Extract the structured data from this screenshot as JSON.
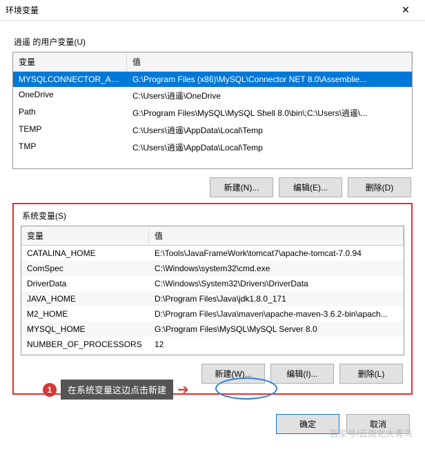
{
  "title": "环境变量",
  "user_section": {
    "label": "逍遥 的用户变量(U)",
    "columns": {
      "name": "变量",
      "value": "值"
    },
    "rows": [
      {
        "name": "MYSQLCONNECTOR_ASS...",
        "value": "G:\\Program Files (x86)\\MySQL\\Connector NET 8.0\\Assemblie...",
        "selected": true
      },
      {
        "name": "OneDrive",
        "value": "C:\\Users\\逍遥\\OneDrive"
      },
      {
        "name": "Path",
        "value": "G:\\Program Files\\MySQL\\MySQL Shell 8.0\\bin\\;C:\\Users\\逍遥\\..."
      },
      {
        "name": "TEMP",
        "value": "C:\\Users\\逍遥\\AppData\\Local\\Temp"
      },
      {
        "name": "TMP",
        "value": "C:\\Users\\逍遥\\AppData\\Local\\Temp"
      }
    ],
    "buttons": {
      "new": "新建(N)...",
      "edit": "编辑(E)...",
      "delete": "删除(D)"
    }
  },
  "sys_section": {
    "label": "系统变量(S)",
    "columns": {
      "name": "变量",
      "value": "值"
    },
    "rows": [
      {
        "name": "CATALINA_HOME",
        "value": "E:\\Tools\\JavaFrameWork\\tomcat7\\apache-tomcat-7.0.94"
      },
      {
        "name": "ComSpec",
        "value": "C:\\Windows\\system32\\cmd.exe"
      },
      {
        "name": "DriverData",
        "value": "C:\\Windows\\System32\\Drivers\\DriverData"
      },
      {
        "name": "JAVA_HOME",
        "value": "D:\\Program Files\\Java\\jdk1.8.0_171"
      },
      {
        "name": "M2_HOME",
        "value": "D:\\Program Files\\Java\\maven\\apache-maven-3.6.2-bin\\apach..."
      },
      {
        "name": "MYSQL_HOME",
        "value": "G:\\Program Files\\MySQL\\MySQL Server 8.0"
      },
      {
        "name": "NUMBER_OF_PROCESSORS",
        "value": "12"
      }
    ],
    "buttons": {
      "new": "新建(W)...",
      "edit": "编辑(I)...",
      "delete": "删除(L)"
    }
  },
  "footer": {
    "ok": "确定",
    "cancel": "取消"
  },
  "annotation": {
    "num": "1",
    "text": "在系统变量这边点击新建"
  },
  "watermark": "百家号/云南北大青鸟"
}
